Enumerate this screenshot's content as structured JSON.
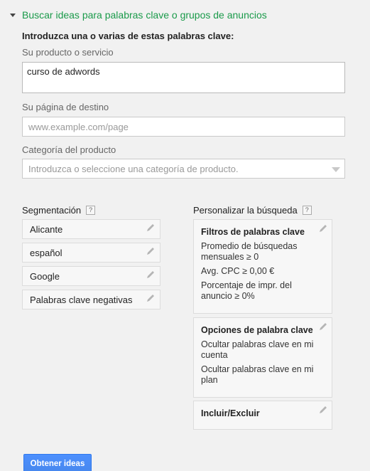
{
  "header": {
    "title": "Buscar ideas para palabras clave o grupos de anuncios"
  },
  "intro": "Introduzca una o varias de estas palabras clave:",
  "product": {
    "label": "Su producto o servicio",
    "value": "curso de adwords"
  },
  "landing": {
    "label": "Su página de destino",
    "placeholder": "www.example.com/page"
  },
  "category": {
    "label": "Categoría del producto",
    "placeholder": "Introduzca o seleccione una categoría de producto."
  },
  "targeting": {
    "title": "Segmentación",
    "help": "?",
    "items": [
      "Alicante",
      "español",
      "Google",
      "Palabras clave negativas"
    ]
  },
  "customize": {
    "title": "Personalizar la búsqueda",
    "help": "?",
    "cards": [
      {
        "title": "Filtros de palabras clave",
        "lines": [
          "Promedio de búsquedas mensuales ≥ 0",
          "Avg. CPC ≥ 0,00 €",
          "Porcentaje de impr. del anuncio ≥ 0%"
        ]
      },
      {
        "title": "Opciones de palabra clave",
        "lines": [
          "Ocultar palabras clave en mi cuenta",
          "Ocultar palabras clave en mi plan"
        ]
      },
      {
        "title": "Incluir/Excluir",
        "lines": []
      }
    ]
  },
  "submit": {
    "label": "Obtener ideas"
  },
  "colors": {
    "header": "#1a9a4a",
    "button": "#4d90fe"
  }
}
